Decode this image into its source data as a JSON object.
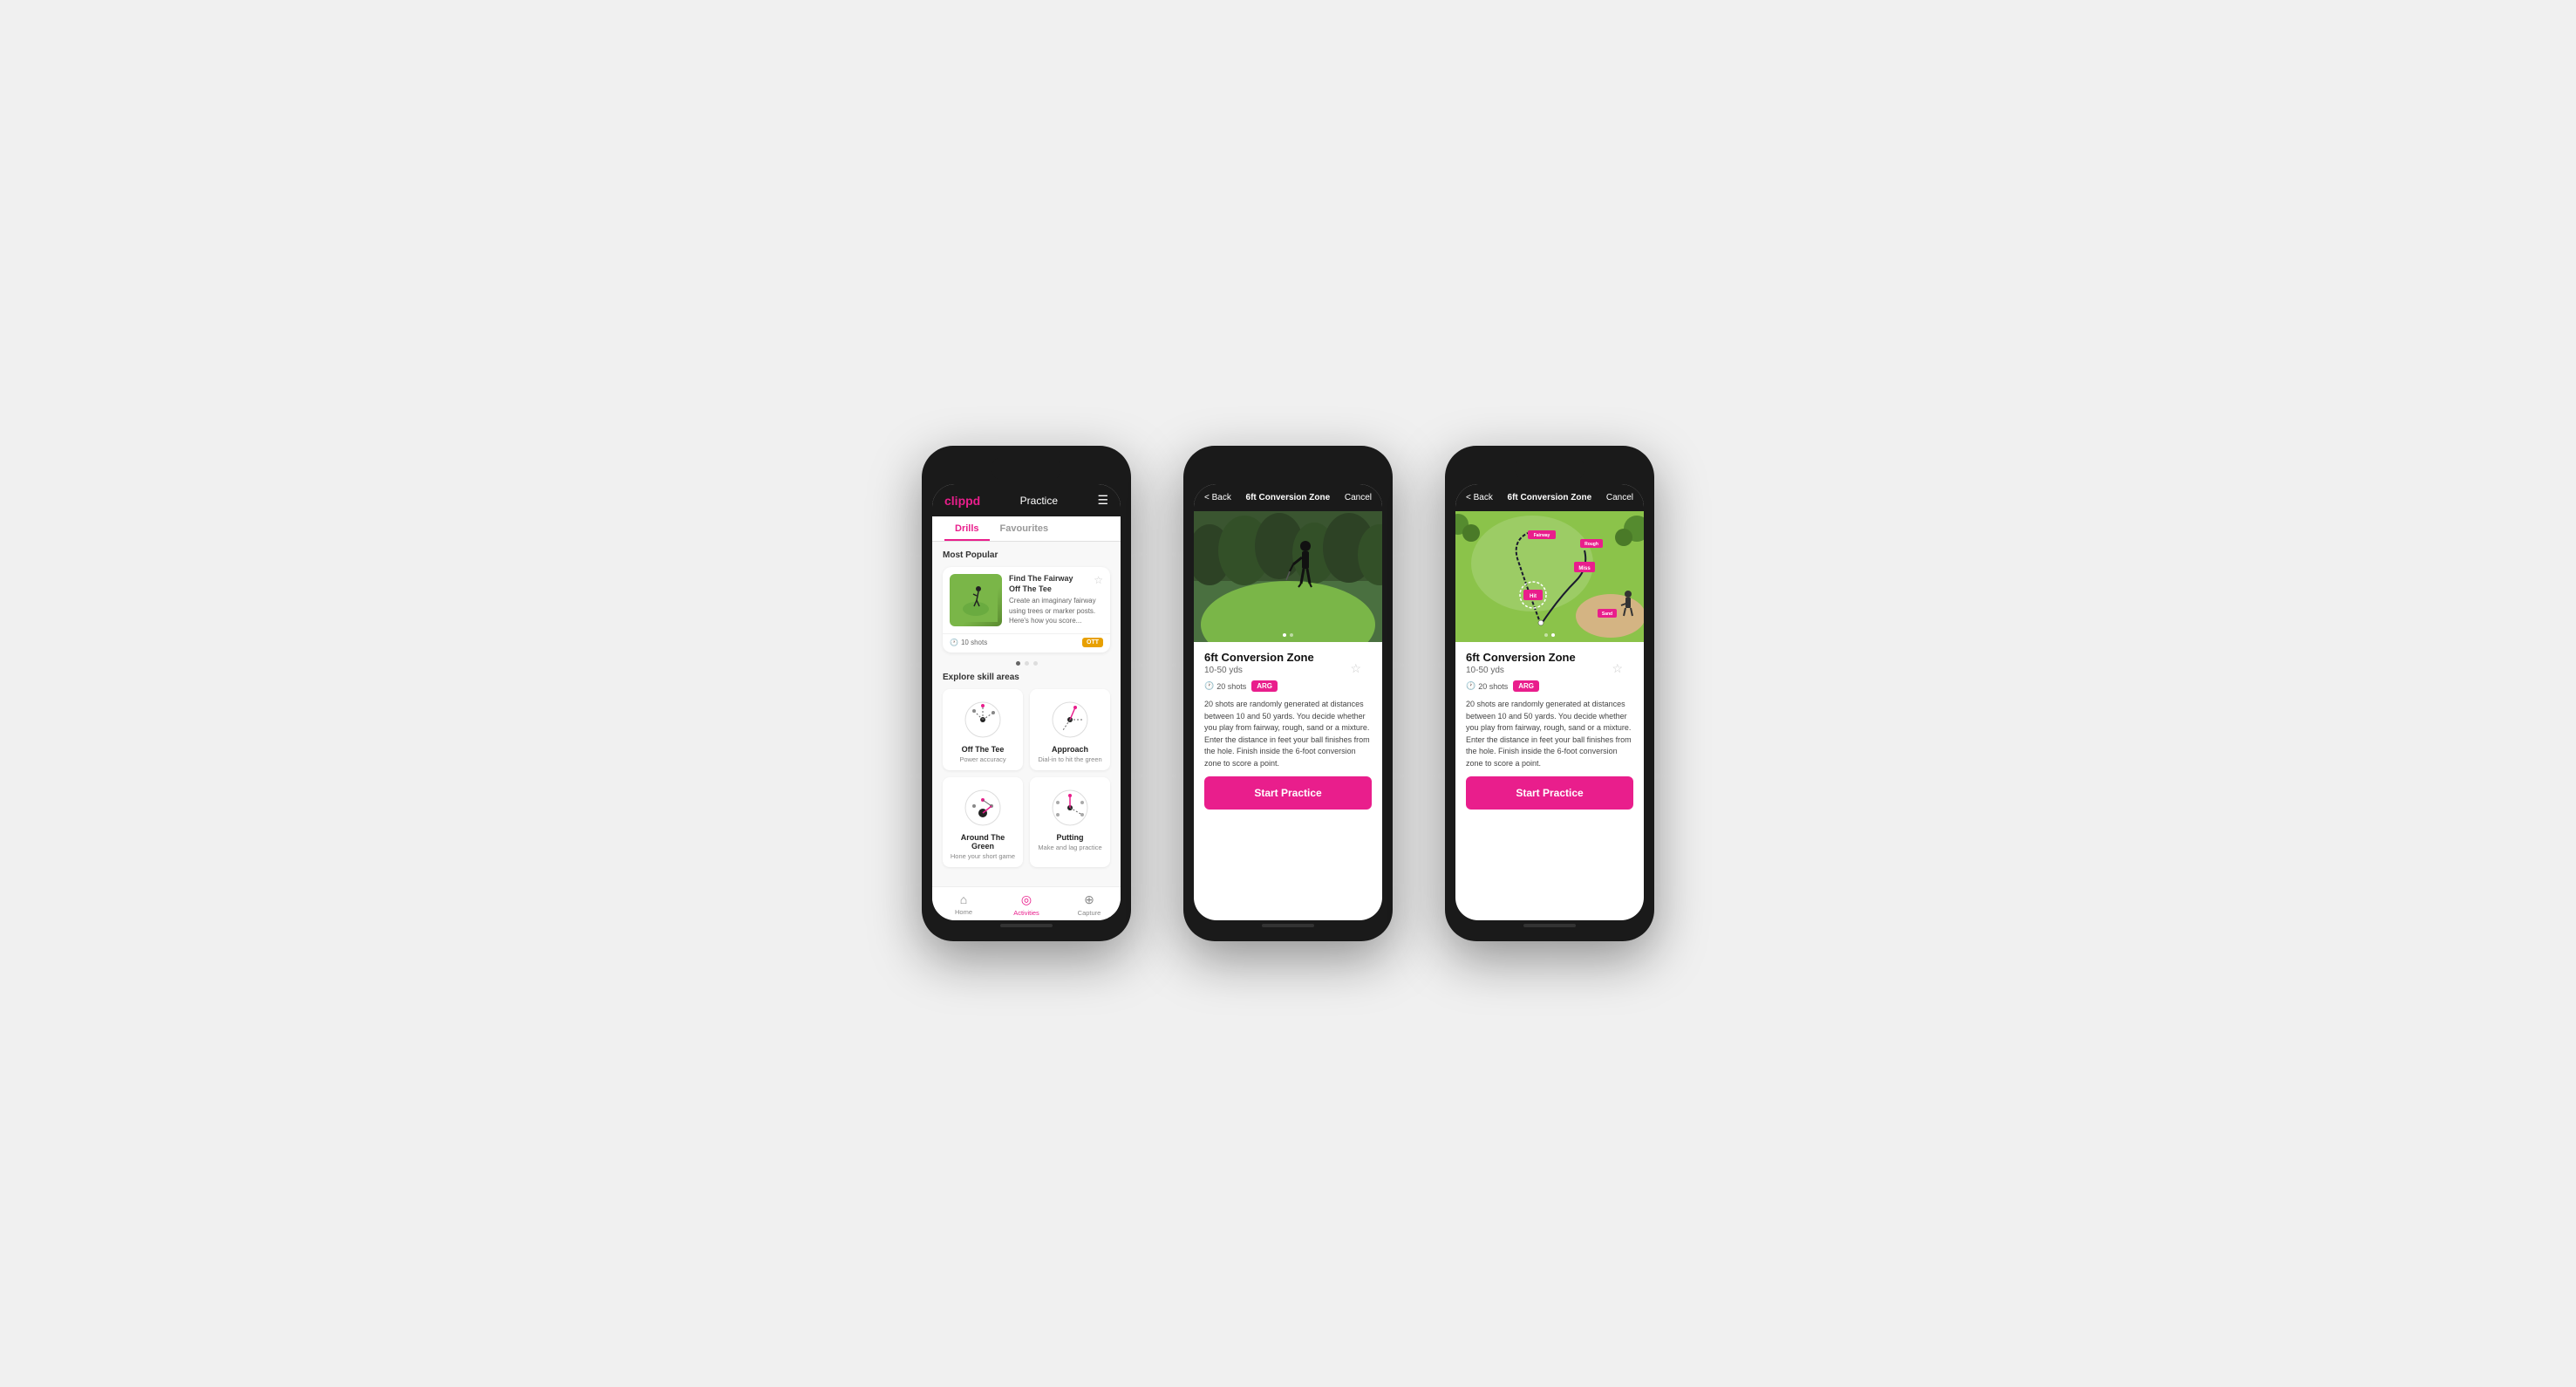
{
  "phone1": {
    "header": {
      "logo": "clippd",
      "title": "Practice",
      "menu_icon": "☰"
    },
    "tabs": [
      "Drills",
      "Favourites"
    ],
    "active_tab": "Drills",
    "most_popular_label": "Most Popular",
    "drill_card": {
      "title": "Find The Fairway",
      "subtitle": "Off The Tee",
      "description": "Create an imaginary fairway using trees or marker posts. Here's how you score...",
      "shots": "10 shots",
      "badge": "OTT",
      "star": "☆"
    },
    "explore_label": "Explore skill areas",
    "skills": [
      {
        "name": "Off The Tee",
        "desc": "Power accuracy"
      },
      {
        "name": "Approach",
        "desc": "Dial-in to hit the green"
      },
      {
        "name": "Around The Green",
        "desc": "Hone your short game"
      },
      {
        "name": "Putting",
        "desc": "Make and lag practice"
      }
    ],
    "nav": [
      {
        "icon": "⌂",
        "label": "Home",
        "active": false
      },
      {
        "icon": "◎",
        "label": "Activities",
        "active": true
      },
      {
        "icon": "⊕",
        "label": "Capture",
        "active": false
      }
    ]
  },
  "phone2": {
    "header": {
      "back": "< Back",
      "title": "6ft Conversion Zone",
      "cancel": "Cancel"
    },
    "drill": {
      "title": "6ft Conversion Zone",
      "distance": "10-50 yds",
      "shots": "20 shots",
      "badge": "ARG",
      "star": "☆",
      "description": "20 shots are randomly generated at distances between 10 and 50 yards. You decide whether you play from fairway, rough, sand or a mixture. Enter the distance in feet your ball finishes from the hole. Finish inside the 6-foot conversion zone to score a point."
    },
    "start_button": "Start Practice",
    "dots": [
      true,
      false
    ]
  },
  "phone3": {
    "header": {
      "back": "< Back",
      "title": "6ft Conversion Zone",
      "cancel": "Cancel"
    },
    "drill": {
      "title": "6ft Conversion Zone",
      "distance": "10-50 yds",
      "shots": "20 shots",
      "badge": "ARG",
      "star": "☆",
      "description": "20 shots are randomly generated at distances between 10 and 50 yards. You decide whether you play from fairway, rough, sand or a mixture. Enter the distance in feet your ball finishes from the hole. Finish inside the 6-foot conversion zone to score a point."
    },
    "start_button": "Start Practice",
    "map_labels": [
      "Fairway",
      "Rough",
      "Miss",
      "Hit",
      "Sand"
    ],
    "dots": [
      false,
      true
    ]
  }
}
